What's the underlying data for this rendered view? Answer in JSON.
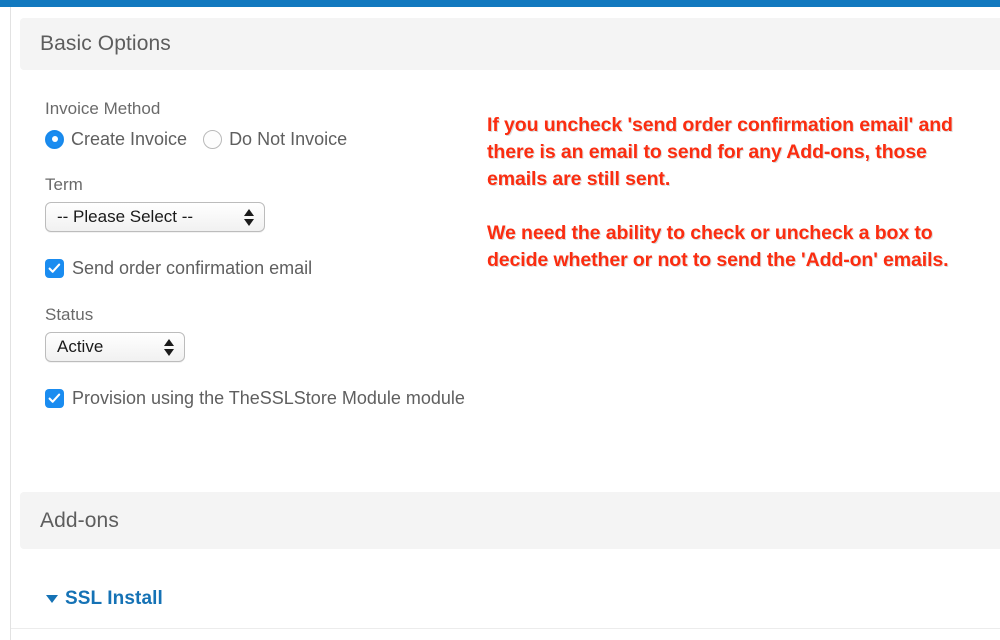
{
  "theme": {
    "accent_bar": "#1279bf",
    "control_blue": "#1a8cf0",
    "link_blue": "#1572b5",
    "annotation_red": "#fb2d10",
    "band_gray": "#f4f4f4",
    "label_gray": "#6a6a6a"
  },
  "sections": {
    "basic": {
      "title": "Basic Options"
    },
    "addons": {
      "title": "Add-ons"
    }
  },
  "form": {
    "invoice_method": {
      "label": "Invoice Method",
      "options": [
        {
          "label": "Create Invoice",
          "selected": true
        },
        {
          "label": "Do Not Invoice",
          "selected": false
        }
      ]
    },
    "term": {
      "label": "Term",
      "value": "-- Please Select --"
    },
    "send_order_confirmation": {
      "label": "Send order confirmation email",
      "checked": true
    },
    "status": {
      "label": "Status",
      "value": "Active"
    },
    "provision": {
      "label": "Provision using the TheSSLStore Module module",
      "checked": true
    }
  },
  "annotation": {
    "paragraph_1": "If you uncheck 'send order confirmation email' and there is an email to send for any Add-ons, those emails are still sent.",
    "paragraph_2": "We need the ability to check or uncheck a box to decide whether or not to send the 'Add-on' emails."
  },
  "addon_items": [
    {
      "label": "SSL Install",
      "expanded": true
    }
  ]
}
